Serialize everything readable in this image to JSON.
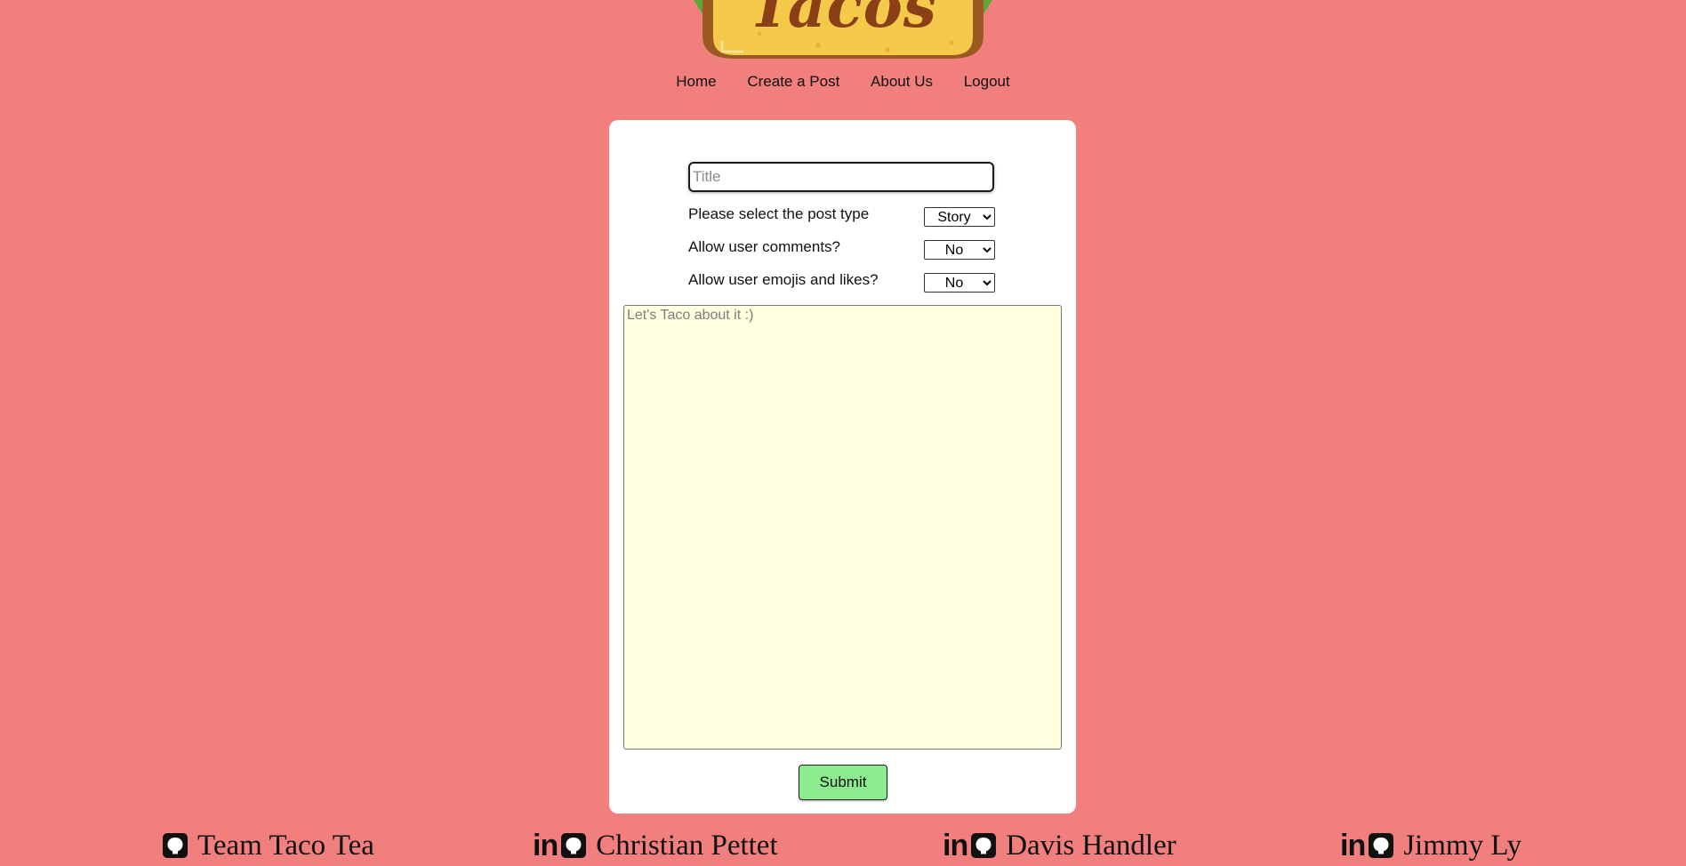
{
  "logo": {
    "text": "Tacos"
  },
  "nav": {
    "items": [
      "Home",
      "Create a Post",
      "About Us",
      "Logout"
    ]
  },
  "form": {
    "title_placeholder": "Title",
    "post_type_label": "Please select the post type",
    "post_type_value": "Story",
    "comments_label": "Allow user comments?",
    "comments_value": "No",
    "emojis_label": "Allow user emojis and likes?",
    "emojis_value": "No",
    "body_placeholder": "Let's Taco about it :)",
    "submit_label": "Submit"
  },
  "footer": {
    "members": [
      {
        "name": "Team Taco Tea",
        "icons": [
          "github-icon"
        ]
      },
      {
        "name": "Christian Pettet",
        "icons": [
          "linkedin-icon",
          "github-icon"
        ]
      },
      {
        "name": "Davis Handler",
        "icons": [
          "linkedin-icon",
          "github-icon"
        ]
      },
      {
        "name": "Jimmy Ly",
        "icons": [
          "linkedin-icon",
          "github-icon"
        ]
      }
    ]
  },
  "colors": {
    "background": "#f07f7d",
    "card": "#ffffff",
    "textarea": "#ffffdf",
    "submit": "#8eea8e",
    "taco_shell": "#f5c94a",
    "logo_text": "#8a3f17"
  }
}
